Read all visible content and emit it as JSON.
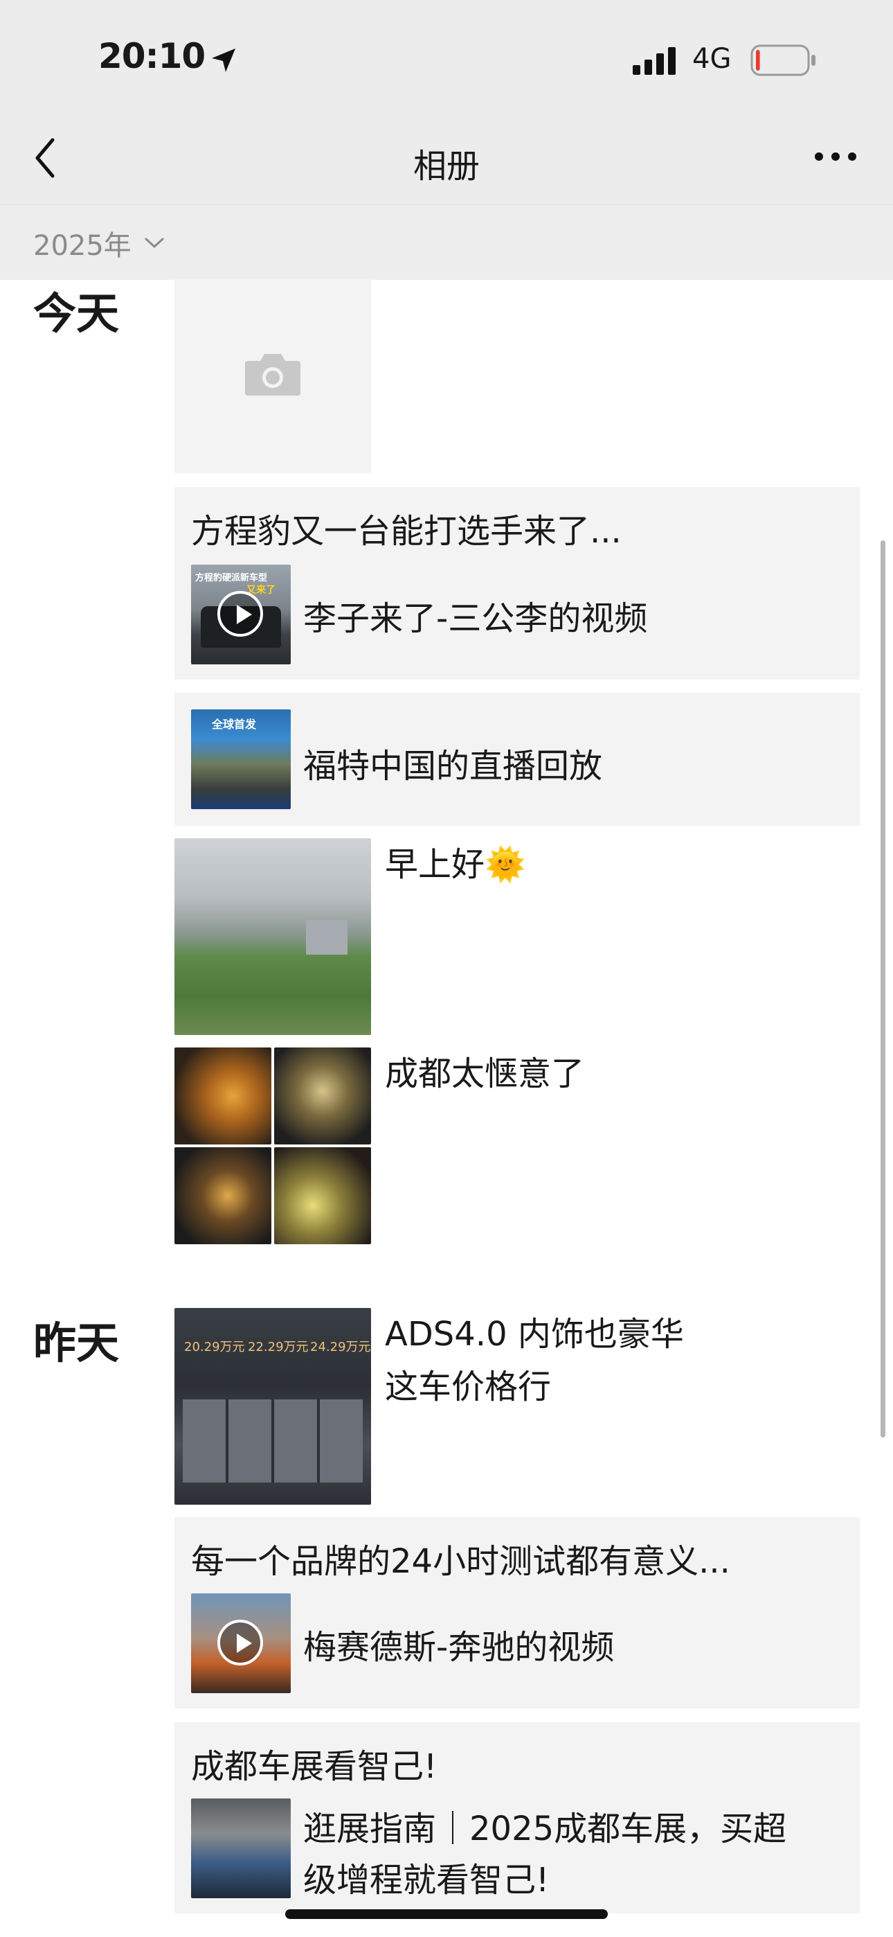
{
  "status_bar": {
    "time": "20:10",
    "network": "4G",
    "battery_level": 0.08,
    "battery_color": "#e63b2e"
  },
  "nav": {
    "title": "相册",
    "back_icon": "chevron-left-icon",
    "more_icon": "more-icon"
  },
  "year_filter": {
    "label": "2025年",
    "icon": "chevron-down-icon"
  },
  "sections": {
    "today": {
      "label": "今天",
      "posts": {
        "camera_tile": {
          "icon": "camera-icon"
        },
        "post1": {
          "text": "方程豹又一台能打选手来了...",
          "link_title": "李子来了-三公李的视频",
          "thumb_caption": "方程豹硬派新车型",
          "thumb_caption2": "又来了"
        },
        "post2": {
          "link_title": "福特中国的直播回放",
          "thumb_caption": "全球首发"
        },
        "post3": {
          "text": "早上好🌞"
        },
        "post4": {
          "text": "成都太惬意了"
        }
      }
    },
    "yesterday": {
      "label": "昨天",
      "posts": {
        "post5": {
          "text_line1": "ADS4.0 内饰也豪华",
          "text_line2": "这车价格行",
          "prices": [
            "20.29万元",
            "22.29万元",
            "24.29万元"
          ]
        },
        "post6": {
          "text": "每一个品牌的24小时测试都有意义...",
          "link_title": "梅赛德斯-奔驰的视频"
        },
        "post7": {
          "text": "成都车展看智己!",
          "link_title_line1": "逛展指南｜2025成都车展，买超",
          "link_title_line2": "级增程就看智己!"
        }
      }
    }
  }
}
